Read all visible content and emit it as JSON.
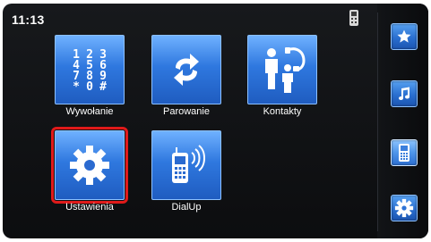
{
  "status": {
    "time": "11:13"
  },
  "tiles": [
    {
      "label": "Wywołanie",
      "icon": "keypad-icon"
    },
    {
      "label": "Parowanie",
      "icon": "sync-arrows-icon"
    },
    {
      "label": "Kontakty",
      "icon": "contacts-icon"
    },
    {
      "label": "Ustawienia",
      "icon": "gear-icon",
      "selected": true
    },
    {
      "label": "DialUp",
      "icon": "mobile-phone-icon"
    }
  ],
  "keypad": [
    "1",
    "2",
    "3",
    "4",
    "5",
    "6",
    "7",
    "8",
    "9",
    "*",
    "0",
    "#"
  ],
  "sidebar": [
    {
      "icon": "star-icon"
    },
    {
      "icon": "music-note-icon"
    },
    {
      "icon": "phone-icon",
      "active": true
    },
    {
      "icon": "gear-icon"
    }
  ],
  "colors": {
    "accent": "#2f78df",
    "selection": "#e01a1a",
    "background": "#0c0d0f"
  }
}
